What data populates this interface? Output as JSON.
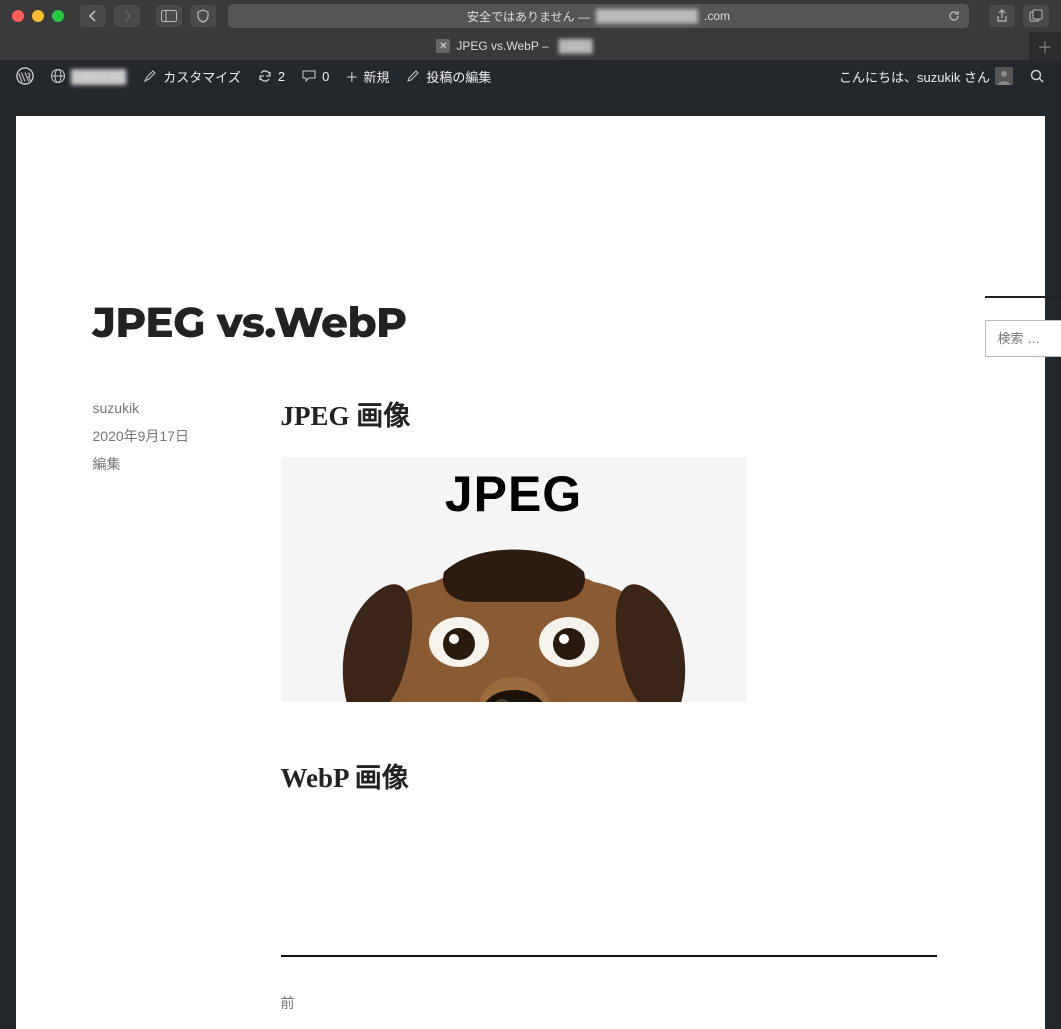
{
  "browser": {
    "address_prefix": "安全ではありません —",
    "domain_suffix": ".com",
    "tab_title": "JPEG vs.WebP –"
  },
  "wp_adminbar": {
    "customize": "カスタマイズ",
    "updates": "2",
    "comments": "0",
    "new": "新規",
    "edit_post": "投稿の編集",
    "greeting": "こんにちは、suzukik さん"
  },
  "post": {
    "title": "JPEG vs.WebP",
    "author": "suzukik",
    "date": "2020年9月17日",
    "edit": "編集",
    "h2_jpeg": "JPEG 画像",
    "h2_webp": "WebP 画像",
    "image_label": "JPEG"
  },
  "sidebar": {
    "search_placeholder": "検索 …"
  },
  "nav": {
    "prev": "前"
  }
}
